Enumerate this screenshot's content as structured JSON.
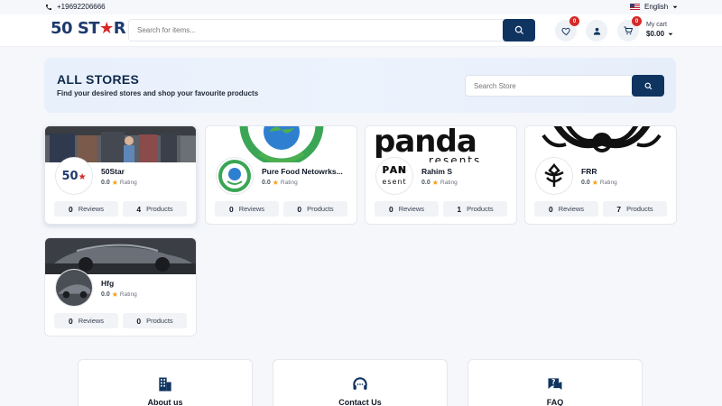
{
  "topbar": {
    "phone": "+19692206666",
    "language": "English"
  },
  "header": {
    "logo_text": "50 ST",
    "logo_star": "★",
    "logo_text_end": "R",
    "search_placeholder": "Search for items...",
    "wishlist_count": "0",
    "cart_count": "0",
    "cart_label": "My cart",
    "cart_amount": "$0.00"
  },
  "hero": {
    "title": "ALL STORES",
    "subtitle": "Find your desired stores and shop your favourite products",
    "search_placeholder": "Search Store"
  },
  "stores": [
    {
      "name": "50Star",
      "rating": "0.0",
      "rating_label": "Rating",
      "reviews": "0",
      "reviews_label": "Reviews",
      "products": "4",
      "products_label": "Products"
    },
    {
      "name": "Pure Food Netowrks...",
      "rating": "0.0",
      "rating_label": "Rating",
      "reviews": "0",
      "reviews_label": "Reviews",
      "products": "0",
      "products_label": "Products"
    },
    {
      "name": "Rahim S",
      "rating": "0.0",
      "rating_label": "Rating",
      "reviews": "0",
      "reviews_label": "Reviews",
      "products": "1",
      "products_label": "Products"
    },
    {
      "name": "FRR",
      "rating": "0.0",
      "rating_label": "Rating",
      "reviews": "0",
      "reviews_label": "Reviews",
      "products": "7",
      "products_label": "Products"
    },
    {
      "name": "Hfg",
      "rating": "0.0",
      "rating_label": "Rating",
      "reviews": "0",
      "reviews_label": "Reviews",
      "products": "0",
      "products_label": "Products"
    }
  ],
  "store_banner_text": {
    "panda": "panda",
    "panda_sub": "resents",
    "avatar_text": "50"
  },
  "footer": {
    "about": "About us",
    "contact": "Contact Us",
    "faq": "FAQ"
  },
  "colors": {
    "primary": "#0f3460",
    "accent": "#d62828",
    "star": "#f59e0b"
  }
}
